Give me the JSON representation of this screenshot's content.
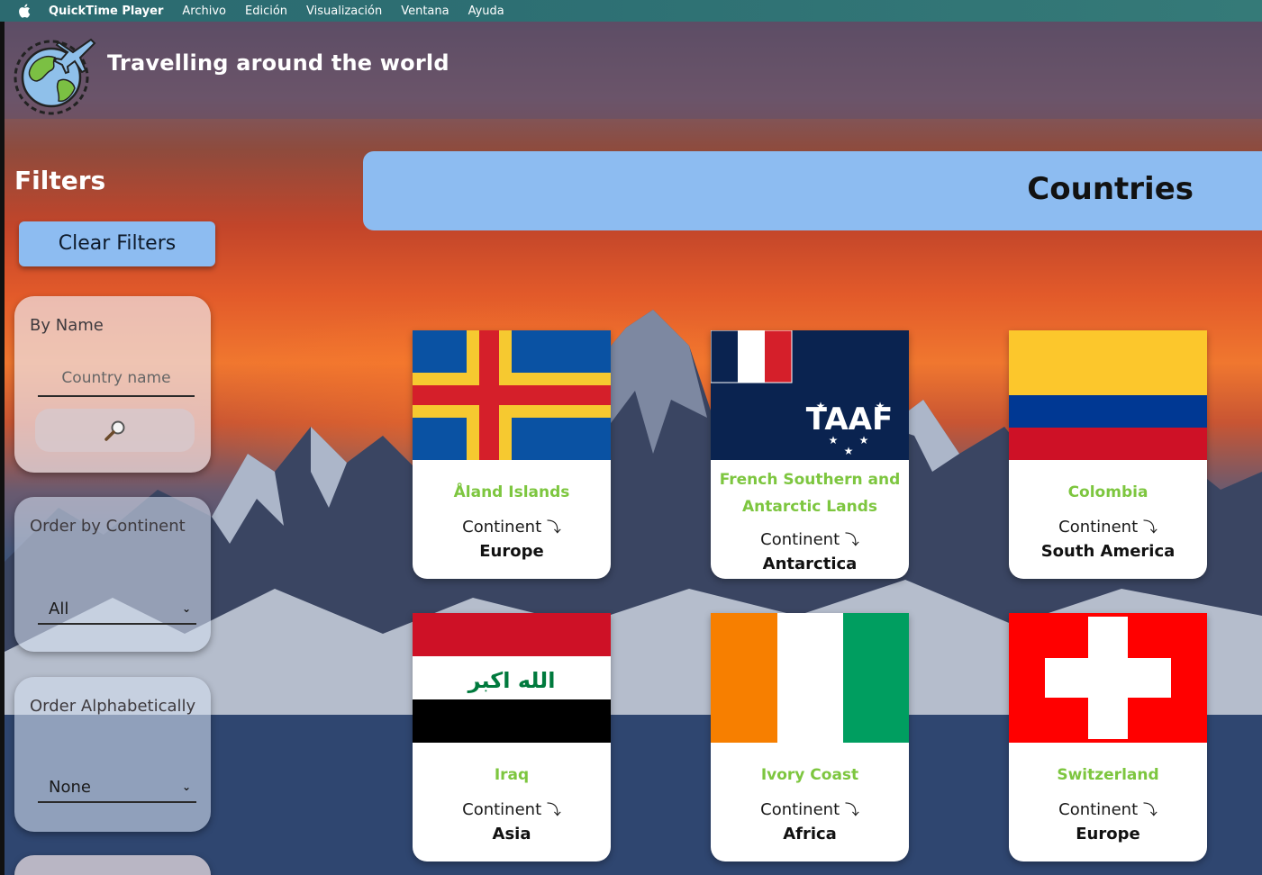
{
  "menubar": {
    "app": "QuickTime Player",
    "items": [
      "Archivo",
      "Edición",
      "Visualización",
      "Ventana",
      "Ayuda"
    ]
  },
  "header": {
    "title": "Travelling around the world",
    "logo_icon": "globe-plane-icon"
  },
  "filters": {
    "title": "Filters",
    "clear_label": "Clear Filters",
    "by_name": {
      "label": "By Name",
      "placeholder": "Country name",
      "search_icon": "search-icon"
    },
    "order_continent": {
      "label": "Order by Continent",
      "selected": "All"
    },
    "order_alpha": {
      "label": "Order Alphabetically",
      "selected": "None"
    }
  },
  "main": {
    "title": "Countries",
    "continent_label": "Continent",
    "continent_arrow": "⤵",
    "cards": [
      {
        "name": "Åland Islands",
        "continent": "Europe",
        "flag": "aland-flag"
      },
      {
        "name": "French Southern and Antarctic Lands",
        "continent": "Antarctica",
        "flag": "french-southern-flag"
      },
      {
        "name": "Colombia",
        "continent": "South America",
        "flag": "colombia-flag"
      },
      {
        "name": "Iraq",
        "continent": "Asia",
        "flag": "iraq-flag"
      },
      {
        "name": "Ivory Coast",
        "continent": "Africa",
        "flag": "ivory-coast-flag"
      },
      {
        "name": "Switzerland",
        "continent": "Europe",
        "flag": "switzerland-flag"
      }
    ]
  },
  "colors": {
    "accent_blue": "#8dbcf1",
    "country_name_green": "#7dc63f"
  }
}
